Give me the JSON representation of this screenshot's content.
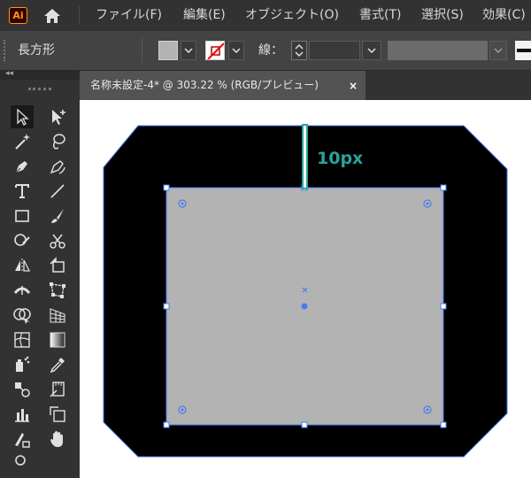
{
  "app": {
    "logo_text": "Ai"
  },
  "menu": {
    "items": [
      "ファイル(F)",
      "編集(E)",
      "オブジェクト(O)",
      "書式(T)",
      "選択(S)",
      "効果(C)"
    ]
  },
  "control_bar": {
    "shape_label": "長方形",
    "stroke_label": "線："
  },
  "document_tab": {
    "title": "名称未設定-4* @ 303.22 % (RGB/プレビュー)",
    "close_glyph": "×"
  },
  "canvas": {
    "dimension_label": "10px",
    "colors": {
      "outer_shape": "#000000",
      "inner_rect": "#b3b3b3",
      "selection": "#4a7cf0",
      "dimension_marker": "#2aa39a"
    }
  },
  "tools": [
    "selection-tool",
    "direct-selection-tool",
    "magic-wand-tool",
    "lasso-tool",
    "pen-tool",
    "curvature-tool",
    "type-tool",
    "line-tool",
    "rectangle-tool",
    "paintbrush-tool",
    "shaper-tool",
    "scissors-tool",
    "reflect-tool",
    "free-transform-tool",
    "width-tool",
    "free-distort-tool",
    "shape-builder-tool",
    "perspective-grid-tool",
    "mesh-tool",
    "gradient-tool",
    "symbol-sprayer-tool",
    "eyedropper-tool",
    "blend-tool",
    "measure-tool",
    "bar-graph-tool",
    "slice-tool",
    "artboard-tool",
    "hand-tool"
  ]
}
